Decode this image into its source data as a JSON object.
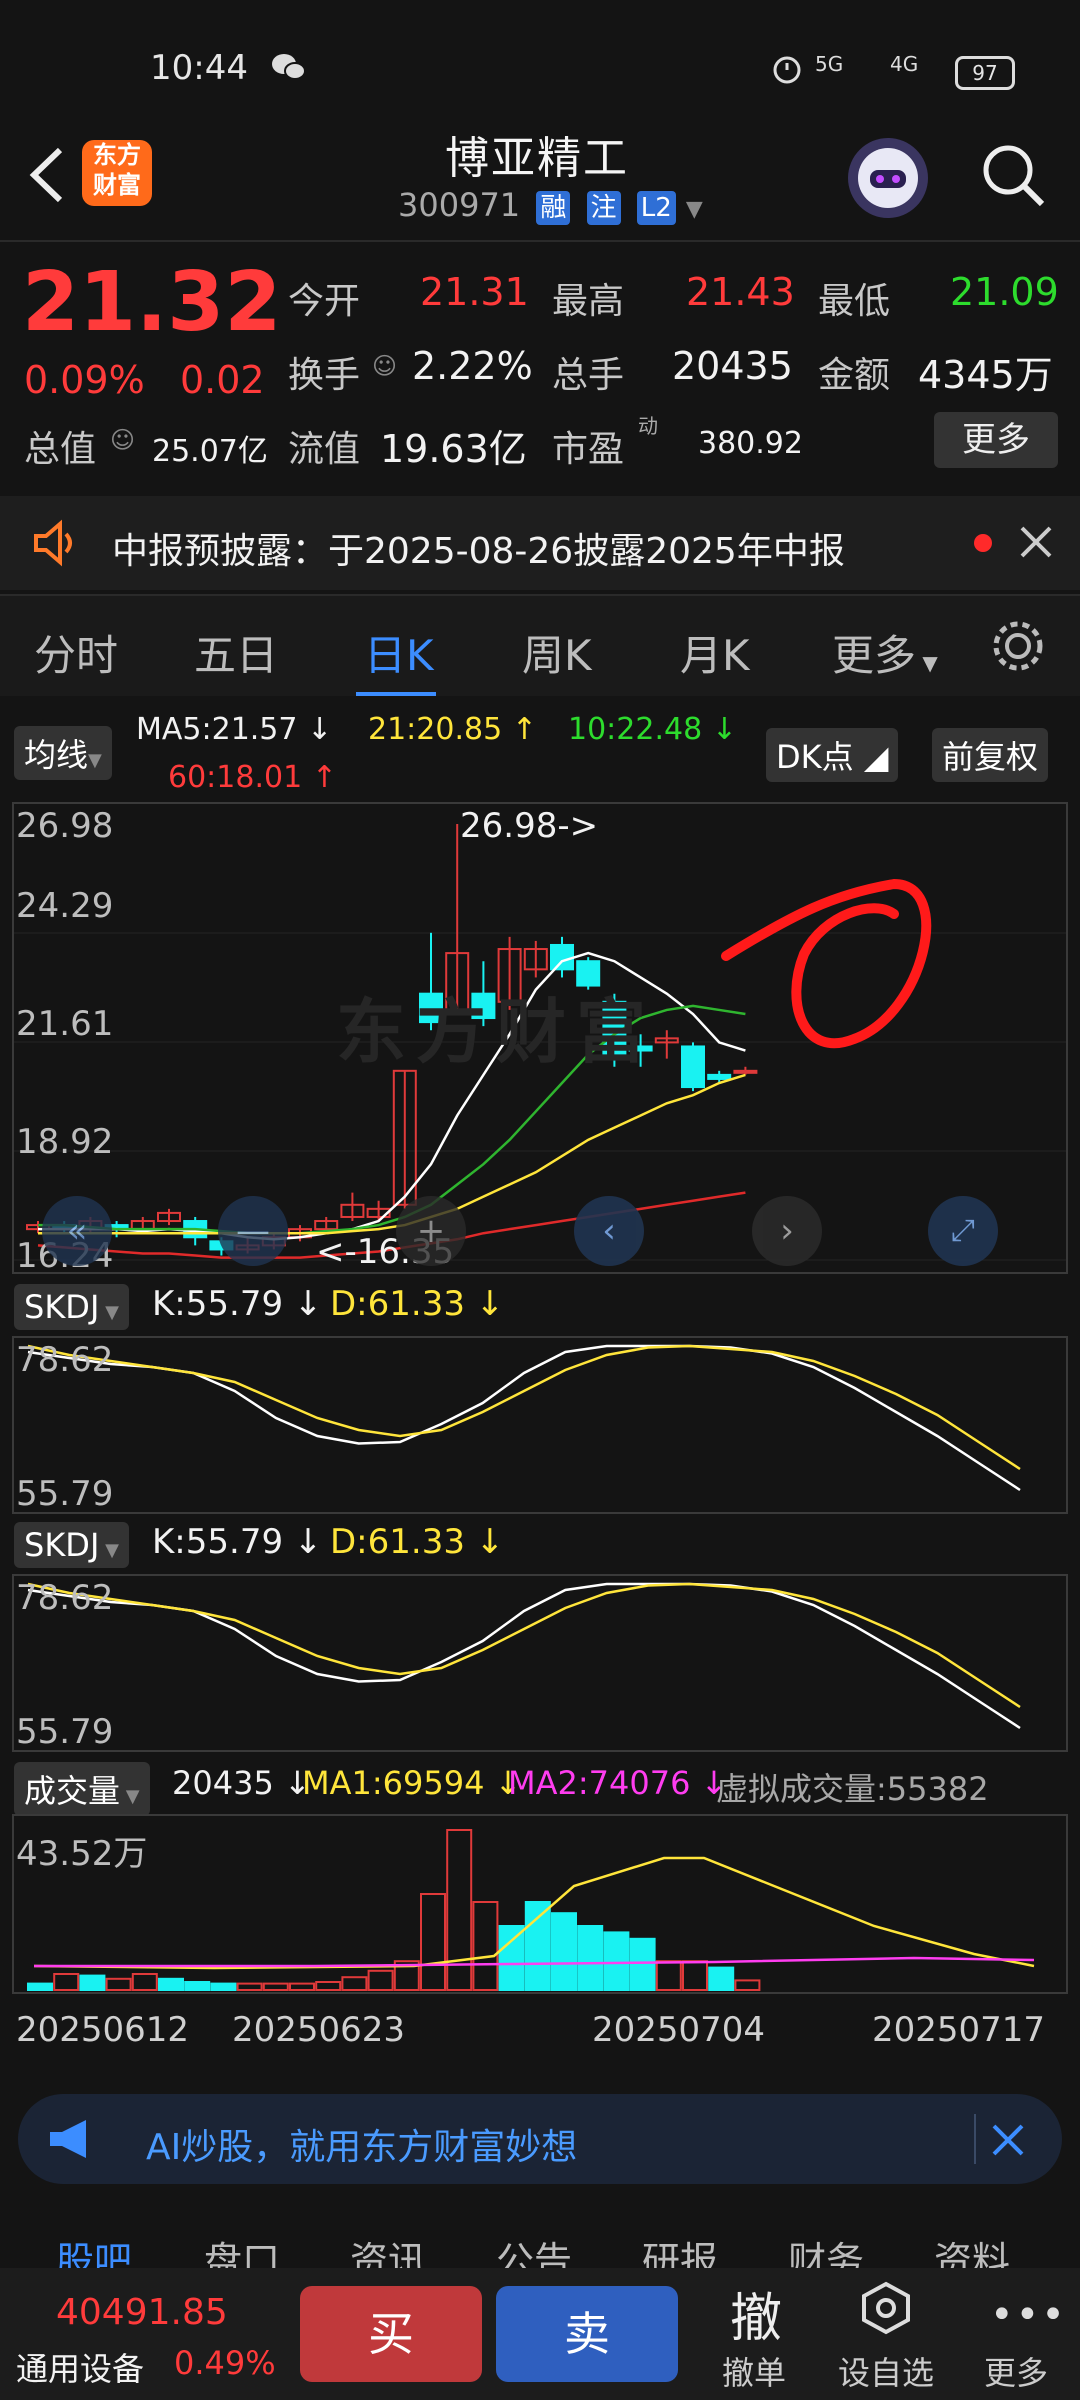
{
  "status_bar": {
    "time": "10:44",
    "battery": "97",
    "net1": "5G",
    "net2": "4G"
  },
  "header": {
    "logo_text_1": "东方",
    "logo_text_2": "财富",
    "title": "博亚精工",
    "code": "300971",
    "badges": [
      "融",
      "注",
      "L2"
    ]
  },
  "quote": {
    "price": "21.32",
    "change_pct": "0.09%",
    "change": "0.02",
    "open_label": "今开",
    "open": "21.31",
    "high_label": "最高",
    "high": "21.43",
    "low_label": "最低",
    "low": "21.09",
    "turnover_label": "换手",
    "turnover": "2.22%",
    "volume_label": "总手",
    "volume": "20435",
    "amount_label": "金额",
    "amount": "4345万",
    "mktcap_label": "总值",
    "mktcap": "25.07亿",
    "float_label": "流值",
    "float_cap": "19.63亿",
    "pe_label": "市盈",
    "pe_sup": "动",
    "pe": "380.92",
    "more_button": "更多"
  },
  "notice": {
    "text": "中报预披露：于2025-08-26披露2025年中报"
  },
  "tabs": {
    "items": [
      "分时",
      "五日",
      "日K",
      "周K",
      "月K",
      "更多"
    ],
    "active": "日K"
  },
  "ma_line": {
    "chip": "均线",
    "ma5": "MA5:21.57",
    "ma21": "21:20.85",
    "ma10": "10:22.48",
    "ma60": "60:18.01",
    "dk_button": "DK点",
    "adjust_button": "前复权"
  },
  "kline": {
    "y_labels": [
      "26.98",
      "24.29",
      "21.61",
      "18.92",
      "16.24"
    ],
    "high_marker": "26.98->",
    "low_marker": "<-16.35",
    "watermark": "东方财富"
  },
  "skdj1": {
    "chip": "SKDJ",
    "k": "K:55.79",
    "d": "D:61.33",
    "top": "78.62",
    "bottom": "55.79"
  },
  "skdj2": {
    "chip": "SKDJ",
    "k": "K:55.79",
    "d": "D:61.33",
    "top": "78.62",
    "bottom": "55.79"
  },
  "volume_panel": {
    "chip": "成交量",
    "vol": "20435",
    "ma1": "MA1:69594",
    "ma2": "MA2:74076",
    "virtual": "虚拟成交量:55382",
    "max_label": "43.52万"
  },
  "dates": [
    "20250612",
    "20250623",
    "20250704",
    "20250717"
  ],
  "ai_banner": {
    "text": "AI炒股，就用东方财富妙想"
  },
  "bottom_tabs": [
    "股吧",
    "盘口",
    "资讯",
    "公告",
    "研报",
    "财务",
    "资料"
  ],
  "bottom_bar": {
    "index_value": "40491.85",
    "index_name": "通用设备",
    "index_pct": "0.49%",
    "buy": "买",
    "sell": "卖",
    "cancel_big": "撤",
    "cancel": "撤单",
    "watch": "设自选",
    "more": "更多"
  },
  "colors": {
    "up": "#ff3b3b",
    "down": "#2ddc2d",
    "accent": "#3c8dff",
    "bull_candle": "#e03a3a",
    "bear_candle": "#19f2f2"
  }
}
